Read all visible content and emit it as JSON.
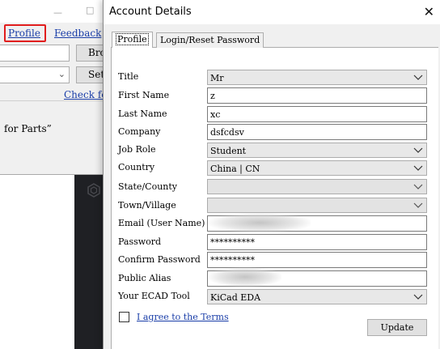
{
  "background_window": {
    "links": {
      "profile": "Profile",
      "feedback": "Feedback",
      "check": "Check fo"
    },
    "buttons": {
      "browse": "Bro",
      "settings": "Sett"
    },
    "partial_text": "for Parts”"
  },
  "dialog": {
    "title": "Account Details",
    "tabs": [
      "Profile",
      "Login/Reset Password"
    ],
    "fields": {
      "title": {
        "label": "Title",
        "value": "Mr"
      },
      "first_name": {
        "label": "First Name",
        "value": "z"
      },
      "last_name": {
        "label": "Last Name",
        "value": "xc"
      },
      "company": {
        "label": "Company",
        "value": "dsfcdsv"
      },
      "job_role": {
        "label": "Job Role",
        "value": "Student"
      },
      "country": {
        "label": "Country",
        "value": "China | CN"
      },
      "state": {
        "label": "State/County",
        "value": ""
      },
      "town": {
        "label": "Town/Village",
        "value": ""
      },
      "email": {
        "label": "Email (User Name)",
        "value": ""
      },
      "password": {
        "label": "Password",
        "value": "**********"
      },
      "confirm_password": {
        "label": "Confirm Password",
        "value": "**********"
      },
      "public_alias": {
        "label": "Public Alias",
        "value": ""
      },
      "ecad_tool": {
        "label": "Your ECAD Tool",
        "value": "KiCad EDA"
      }
    },
    "terms_label": "I agree to the Terms",
    "terms_checked": false,
    "update_label": "Update"
  },
  "colors": {
    "link": "#1a3ea8",
    "highlight": "#e11d1d",
    "dark_strip": "#1f2024"
  },
  "icons": [
    "close-icon",
    "chevron-down-icon",
    "checkbox-icon"
  ]
}
